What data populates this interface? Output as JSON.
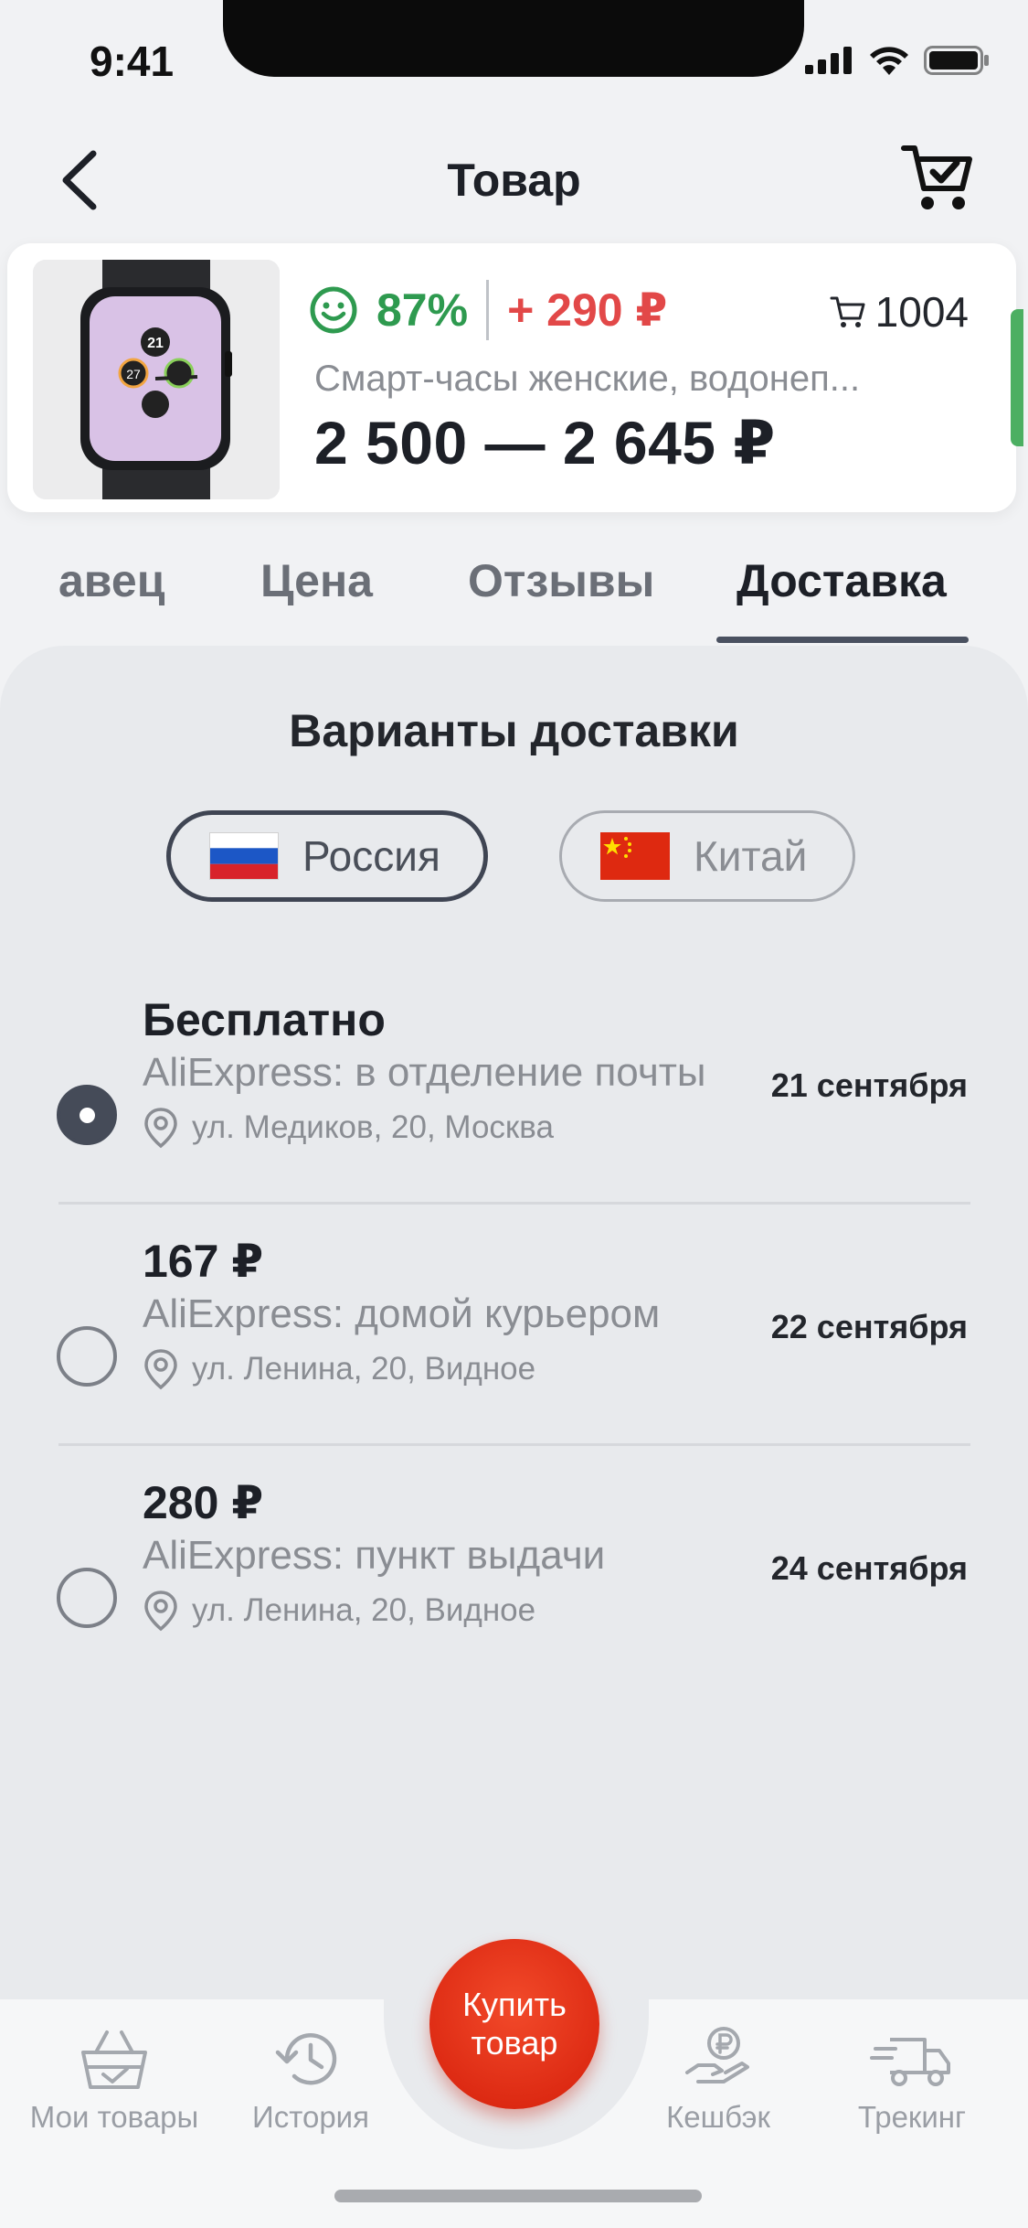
{
  "status_bar": {
    "time": "9:41"
  },
  "header": {
    "title": "Товар"
  },
  "product": {
    "rating": "87%",
    "price_diff": "+ 290 ₽",
    "sold": "1004",
    "name": "Смарт-часы женские, водонеп...",
    "price_range": "2 500 — 2 645 ₽",
    "watch_date": "21",
    "watch_dial": "27"
  },
  "tabs": [
    "авец",
    "Цена",
    "Отзывы",
    "Доставка"
  ],
  "delivery": {
    "title": "Варианты доставки",
    "countries": [
      "Россия",
      "Китай"
    ],
    "options": [
      {
        "price": "Бесплатно",
        "method": "AliExpress: в отделение почты",
        "address": "ул. Медиков, 20, Москва",
        "date": "21 сентября",
        "selected": true
      },
      {
        "price": "167 ₽",
        "method": "AliExpress: домой курьером",
        "address": "ул. Ленина, 20, Видное",
        "date": "22 сентября",
        "selected": false
      },
      {
        "price": "280 ₽",
        "method": "AliExpress: пункт выдачи",
        "address": "ул. Ленина, 20, Видное",
        "date": "24 сентября",
        "selected": false
      }
    ]
  },
  "bottom_nav": {
    "items": [
      "Мои товары",
      "История",
      "Кешбэк",
      "Трекинг"
    ],
    "buy_label_1": "Купить",
    "buy_label_2": "товар"
  },
  "colors": {
    "accent": "#e0260f",
    "rating_green": "#2e9a4f",
    "price_red": "#e24848"
  }
}
